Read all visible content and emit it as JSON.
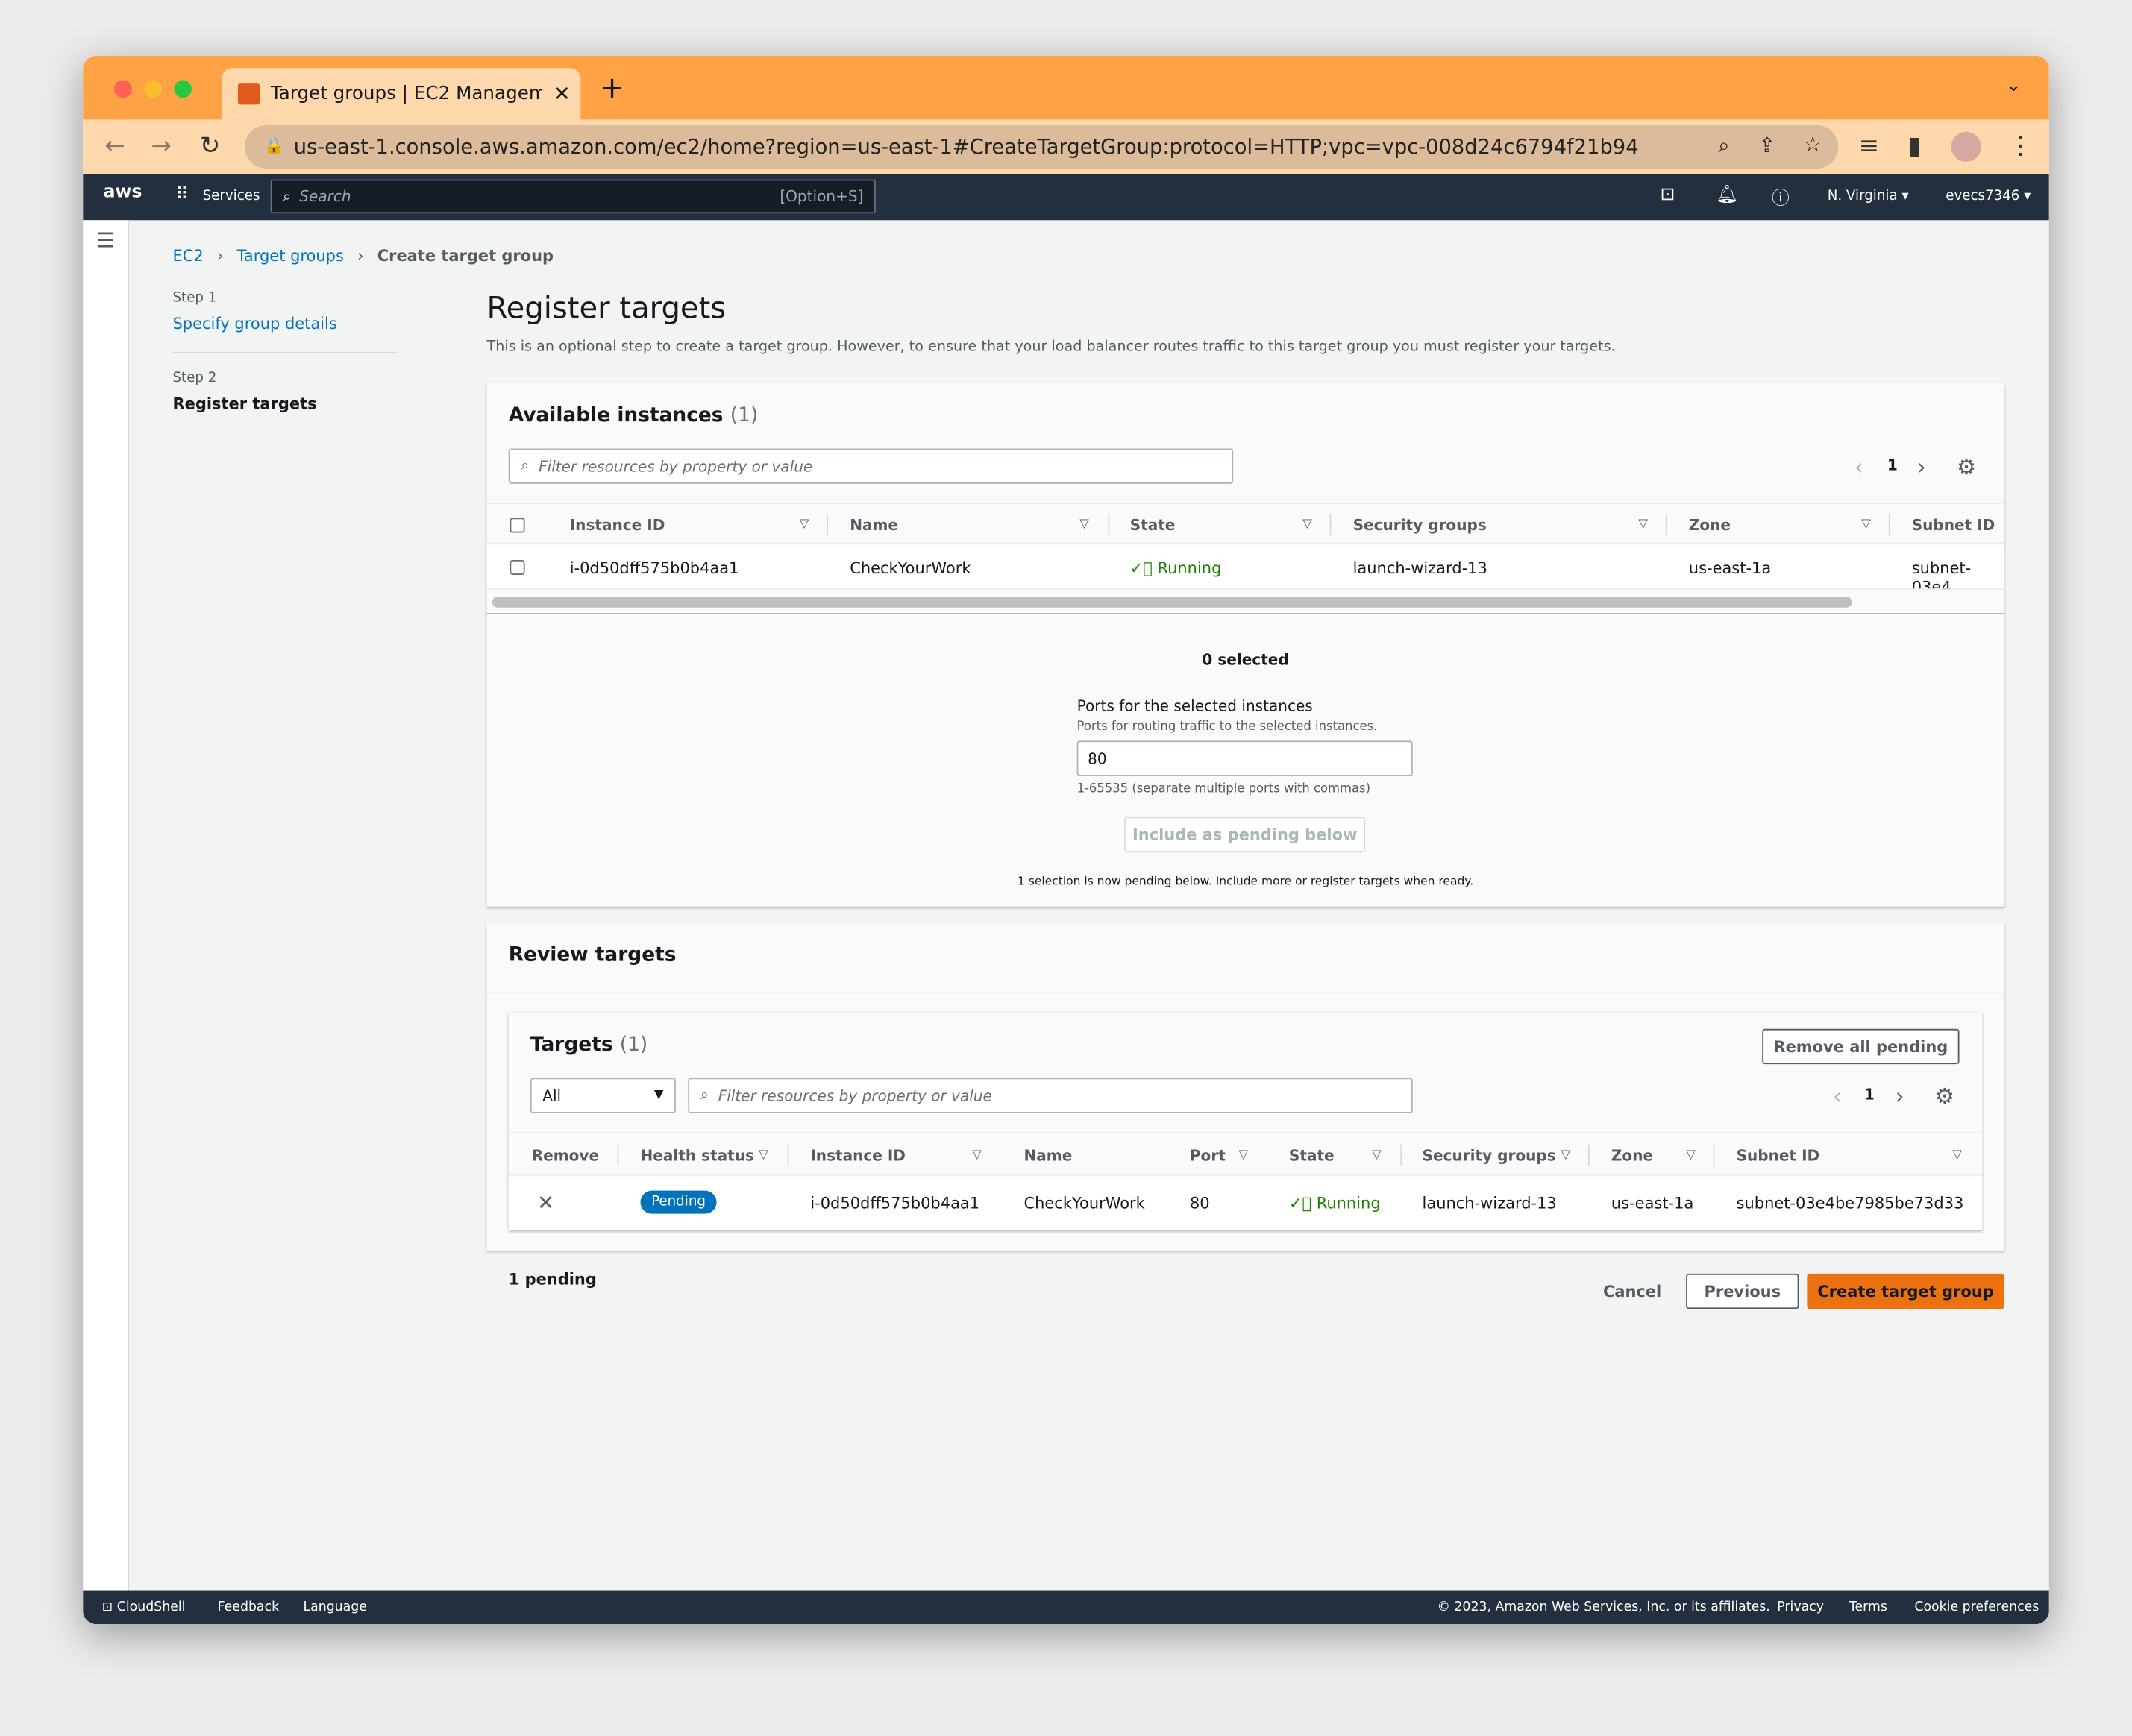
{
  "browser": {
    "tab_title": "Target groups | EC2 Manageme",
    "url": "us-east-1.console.aws.amazon.com/ec2/home?region=us-east-1#CreateTargetGroup:protocol=HTTP;vpc=vpc-008d24c6794f21b94"
  },
  "aws_nav": {
    "logo": "aws",
    "services": "Services",
    "search_placeholder": "Search",
    "search_shortcut": "[Option+S]",
    "region": "N. Virginia",
    "account": "evecs7346"
  },
  "breadcrumb": [
    "EC2",
    "Target groups",
    "Create target group"
  ],
  "steps": [
    {
      "step": "Step 1",
      "label": "Specify group details"
    },
    {
      "step": "Step 2",
      "label": "Register targets"
    }
  ],
  "page": {
    "title": "Register targets",
    "description": "This is an optional step to create a target group. However, to ensure that your load balancer routes traffic to this target group you must register your targets."
  },
  "available": {
    "title": "Available instances",
    "count": "(1)",
    "filter_placeholder": "Filter resources by property or value",
    "page": "1",
    "columns": [
      "Instance ID",
      "Name",
      "State",
      "Security groups",
      "Zone",
      "Subnet ID"
    ],
    "rows": [
      {
        "instance_id": "i-0d50dff575b0b4aa1",
        "name": "CheckYourWork",
        "state": "Running",
        "security_groups": "launch-wizard-13",
        "zone": "us-east-1a",
        "subnet": "subnet-03e4"
      }
    ],
    "selected": "0 selected",
    "ports_label": "Ports for the selected instances",
    "ports_desc": "Ports for routing traffic to the selected instances.",
    "ports_value": "80",
    "ports_hint": "1-65535 (separate multiple ports with commas)",
    "include_button": "Include as pending below",
    "pending_note": "1 selection is now pending below. Include more or register targets when ready."
  },
  "review": {
    "title": "Review targets",
    "targets_title": "Targets",
    "targets_count": "(1)",
    "remove_all": "Remove all pending",
    "filter_select": "All",
    "filter_placeholder": "Filter resources by property or value",
    "page": "1",
    "columns": [
      "Remove",
      "Health status",
      "Instance ID",
      "Name",
      "Port",
      "State",
      "Security groups",
      "Zone",
      "Subnet ID"
    ],
    "rows": [
      {
        "health": "Pending",
        "instance_id": "i-0d50dff575b0b4aa1",
        "name": "CheckYourWork",
        "port": "80",
        "state": "Running",
        "security_groups": "launch-wizard-13",
        "zone": "us-east-1a",
        "subnet": "subnet-03e4be7985be73d33"
      }
    ]
  },
  "actions": {
    "pending": "1 pending",
    "cancel": "Cancel",
    "previous": "Previous",
    "create": "Create target group"
  },
  "footer": {
    "cloudshell": "CloudShell",
    "feedback": "Feedback",
    "language": "Language",
    "copyright": "© 2023, Amazon Web Services, Inc. or its affiliates.",
    "privacy": "Privacy",
    "terms": "Terms",
    "cookies": "Cookie preferences"
  },
  "colors": {
    "accent": "#ec7211",
    "link": "#0073bb",
    "running": "#1d8102",
    "nav": "#232f3e",
    "pending_badge": "#0073bb"
  }
}
